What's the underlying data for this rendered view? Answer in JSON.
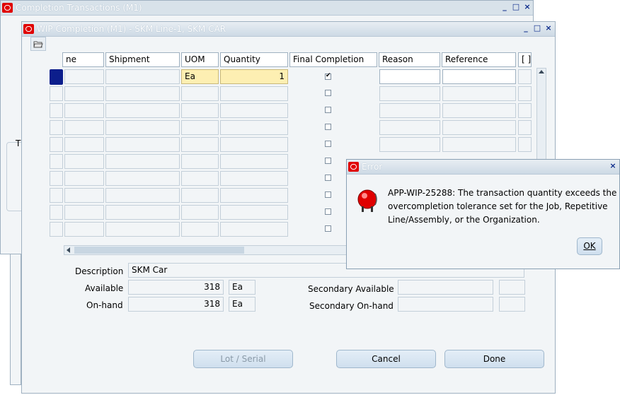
{
  "back_window": {
    "title": "Completion Transactions (M1)",
    "partial_label": "T"
  },
  "main_window": {
    "title": "WIP Completion (M1) - SKM Line-1, SKM CAR",
    "columns": [
      "ne",
      "Shipment",
      "UOM",
      "Quantity",
      "Final Completion",
      "Reason",
      "Reference",
      "[ ]"
    ],
    "first_row": {
      "uom": "Ea",
      "quantity": "1"
    },
    "description_label": "Description",
    "description_value": "SKM Car",
    "available_label": "Available",
    "available_value": "318",
    "available_uom": "Ea",
    "onhand_label": "On-hand",
    "onhand_value": "318",
    "onhand_uom": "Ea",
    "secondary_available_label": "Secondary Available",
    "secondary_onhand_label": "Secondary On-hand",
    "buttons": {
      "lot_serial": "Lot / Serial",
      "cancel": "Cancel",
      "done": "Done"
    }
  },
  "error_dialog": {
    "title": "Error",
    "line1": "APP-WIP-25288: The transaction quantity exceeds the",
    "line2": "overcompletion tolerance set for the Job, Repetitive",
    "line3": "Line/Assembly, or the Organization.",
    "ok_label": "OK"
  },
  "window_controls": {
    "minimize": "_",
    "restore": "□",
    "close": "×"
  },
  "icons": {
    "toolbar": "folder-open-icon",
    "error": "alarm-bell-icon",
    "logo": "oracle-logo-icon"
  },
  "colors": {
    "title_text": "#ffffff",
    "current_row": "#fdefb2",
    "row_marker": "#0c1e8c",
    "bell": "#e00000"
  }
}
